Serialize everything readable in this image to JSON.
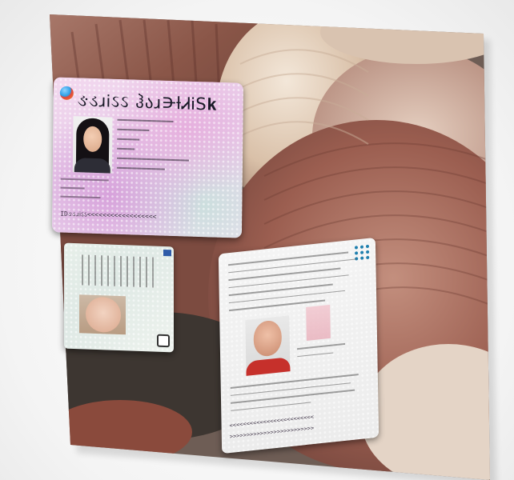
{
  "scene": {
    "description_colors": {
      "background": "#f4f4f4",
      "shell_dark": "#7b4a3f",
      "shell_light": "#e8d7c4",
      "card1_tint": "#e7cbe8",
      "card2_tint": "#dfe9e5",
      "card3_tint": "#ececec",
      "accent_blue": "#1f7fae"
    }
  },
  "card1": {
    "title": "ઙડɹᎥઽઽ ჰაɹ𝈁ƚᏗᎥS𝐤",
    "mrz_line": "IDઙડɹᎥઽઽ<<<<<<<<<<<<<<<<<<"
  },
  "card2": {},
  "card3": {
    "mrz_line1": "<<<<<<<<<<<<<<<<<<<<<<<<<",
    "mrz_line2": ">>>>>>>>>>>>>>>>>>>>>>>>>"
  }
}
